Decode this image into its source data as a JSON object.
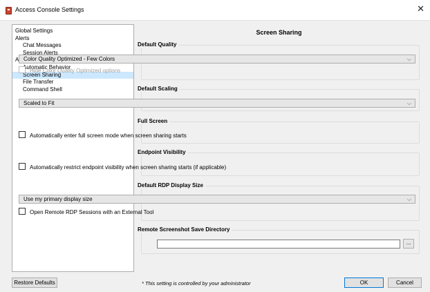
{
  "window": {
    "title": "Access Console Settings",
    "close_glyph": "✕",
    "icon": "app-icon"
  },
  "sidebar": {
    "items": [
      {
        "label": "Global Settings",
        "level": 0,
        "selected": false
      },
      {
        "label": "Alerts",
        "level": 0,
        "selected": false
      },
      {
        "label": "Chat Messages",
        "level": 1,
        "selected": false
      },
      {
        "label": "Session Alerts",
        "level": 1,
        "selected": false
      },
      {
        "label": "Access Sessions",
        "level": 0,
        "selected": false
      },
      {
        "label": "Automatic Behavior",
        "level": 1,
        "selected": false
      },
      {
        "label": "Screen Sharing",
        "level": 1,
        "selected": true
      },
      {
        "label": "File Transfer",
        "level": 1,
        "selected": false
      },
      {
        "label": "Command Shell",
        "level": 1,
        "selected": false
      }
    ]
  },
  "main": {
    "title": "Screen Sharing",
    "default_quality": {
      "label": "Default Quality",
      "select_value": "Color Quality Optimized - Few Colors",
      "hide_option_label": "Hide Color Quality Optimized options",
      "hide_option_checked": false,
      "hide_option_disabled": true
    },
    "default_scaling": {
      "label": "Default Scaling",
      "select_value": "Scaled to Fit"
    },
    "full_screen": {
      "label": "Full Screen",
      "checkbox_label": "Automatically enter full screen mode when screen sharing starts",
      "checked": false
    },
    "endpoint_visibility": {
      "label": "Endpoint Visibility",
      "checkbox_label": "Automatically restrict endpoint visibility when screen sharing starts (if applicable)",
      "checked": false
    },
    "rdp_display": {
      "label": "Default RDP Display Size",
      "select_value": "Use my primary display size",
      "checkbox_label": "Open Remote RDP Sessions with an External Tool",
      "checked": false
    },
    "screenshot_dir": {
      "label": "Remote Screenshot Save Directory",
      "value": "",
      "browse_label": "..."
    }
  },
  "footer": {
    "restore_label": "Restore Defaults",
    "note": "* This setting is controlled by your administrator",
    "ok_label": "OK",
    "cancel_label": "Cancel"
  },
  "colors": {
    "selection": "#cce8ff",
    "window_bg": "#f0f0f0",
    "default_button_border": "#0078d7"
  }
}
